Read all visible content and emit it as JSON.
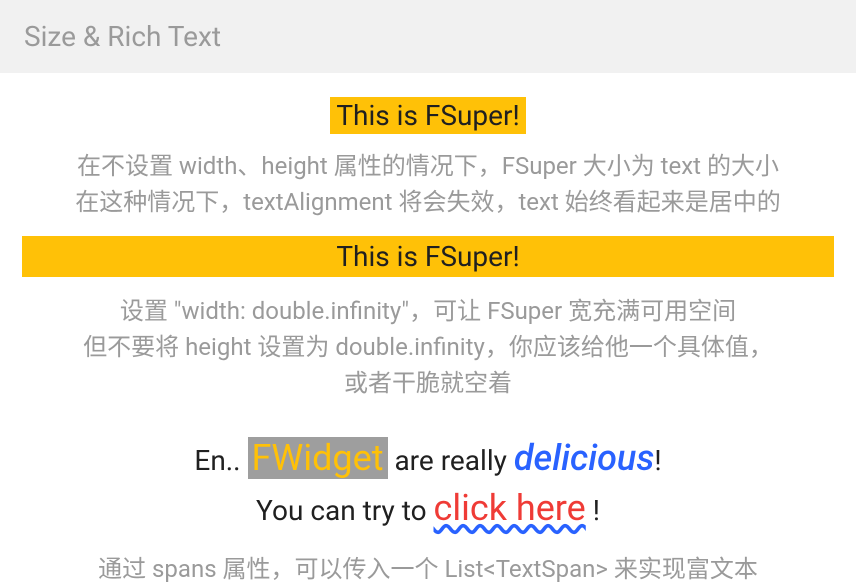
{
  "header": {
    "title": "Size & Rich Text"
  },
  "banner_small": "This is FSuper!",
  "desc1_line1": "在不设置 width、height 属性的情况下，FSuper 大小为 text 的大小",
  "desc1_line2": "在这种情况下，textAlignment 将会失效，text 始终看起来是居中的",
  "banner_full": "This is FSuper!",
  "desc2_line1": "设置 \"width: double.infinity\"，可让 FSuper 宽充满可用空间",
  "desc2_line2": "但不要将 height 设置为 double.infinity，你应该给他一个具体值，",
  "desc2_line3": "或者干脆就空着",
  "rich": {
    "prefix": "En.. ",
    "fwidget": "FWidget",
    "mid": " are really ",
    "delicious": "delicious",
    "excl": "!",
    "line2_prefix": "You can try to ",
    "click_here": "click here",
    "line2_suffix": " !"
  },
  "desc3": "通过 spans 属性，可以传入一个 List<TextSpan> 来实现富文本"
}
